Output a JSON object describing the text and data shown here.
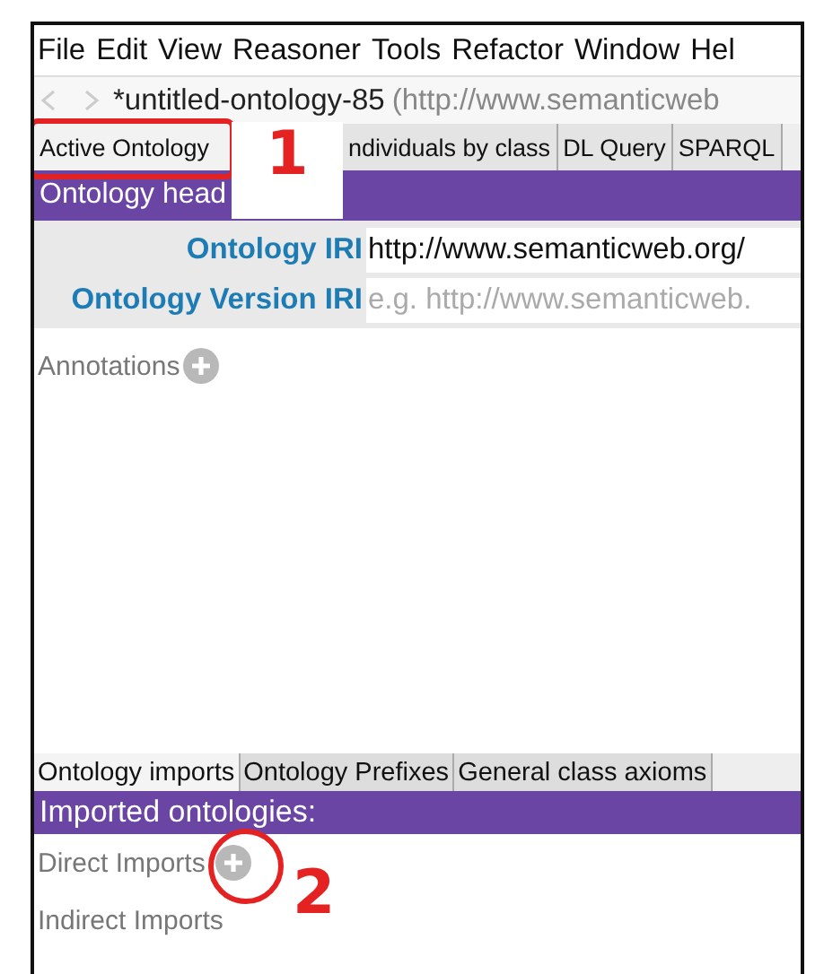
{
  "menu": [
    "File",
    "Edit",
    "View",
    "Reasoner",
    "Tools",
    "Refactor",
    "Window",
    "Hel"
  ],
  "title": {
    "name": "*untitled-ontology-85",
    "iri": "(http://www.semanticweb"
  },
  "tabs": [
    {
      "label": "Active Ontology",
      "selected": true
    },
    {
      "label": "ndividuals by class",
      "selected": false
    },
    {
      "label": "DL Query",
      "selected": false
    },
    {
      "label": "SPARQL",
      "selected": false
    }
  ],
  "header_section": {
    "title": "Ontology head"
  },
  "fields": [
    {
      "label": "Ontology IRI",
      "value": "http://www.semanticweb.org/"
    },
    {
      "label": "Ontology Version IRI",
      "placeholder": "e.g. http://www.semanticweb."
    }
  ],
  "annotations": {
    "label": "Annotations"
  },
  "bottom_tabs": [
    {
      "label": "Ontology imports",
      "selected": true
    },
    {
      "label": "Ontology Prefixes",
      "selected": false
    },
    {
      "label": "General class axioms",
      "selected": false
    }
  ],
  "imports_section": {
    "title": "Imported ontologies:",
    "direct": "Direct Imports",
    "indirect": "Indirect Imports"
  },
  "callouts": [
    {
      "number": "1"
    },
    {
      "number": "2"
    }
  ]
}
